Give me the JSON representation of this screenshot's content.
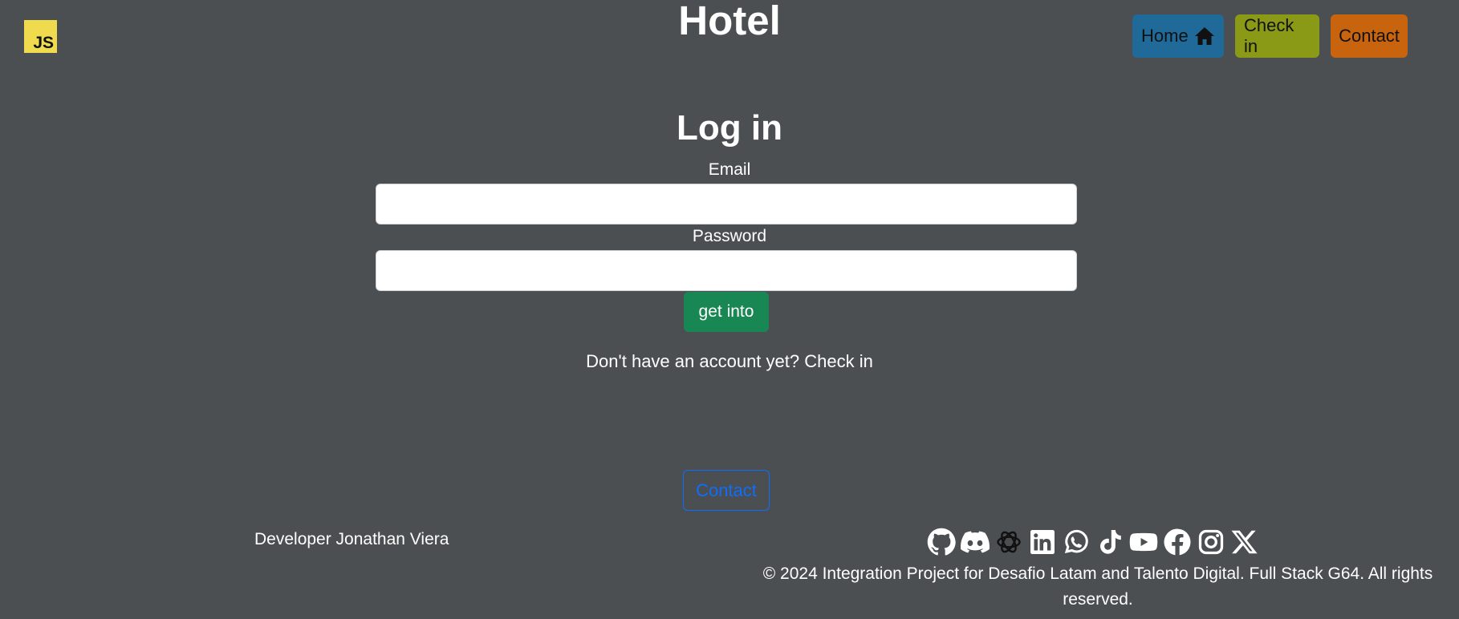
{
  "header": {
    "logo_text": "JS",
    "site_title": "Hotel",
    "nav": [
      {
        "label": "Home",
        "icon": "home-icon",
        "color": "#1f6a99"
      },
      {
        "label": "Check in",
        "color": "#8a9a16"
      },
      {
        "label": "Contact",
        "color": "#c8640d"
      }
    ]
  },
  "login": {
    "title": "Log in",
    "email_label": "Email",
    "email_value": "",
    "password_label": "Password",
    "password_value": "",
    "submit_label": "get into",
    "submit_color": "#198754",
    "signup_text": "Don't have an account yet? Check in"
  },
  "footer": {
    "contact_label": "Contact",
    "developer": "Developer Jonathan Viera",
    "social_icons": [
      "github-icon",
      "discord-icon",
      "openai-icon",
      "linkedin-icon",
      "whatsapp-icon",
      "tiktok-icon",
      "youtube-icon",
      "facebook-icon",
      "instagram-icon",
      "x-icon"
    ],
    "copyright": "© 2024 Integration Project for Desafio Latam and Talento Digital. Full Stack G64. All rights reserved."
  },
  "colors": {
    "background": "#4b4f51",
    "contact_outline": "#0d6efd"
  }
}
